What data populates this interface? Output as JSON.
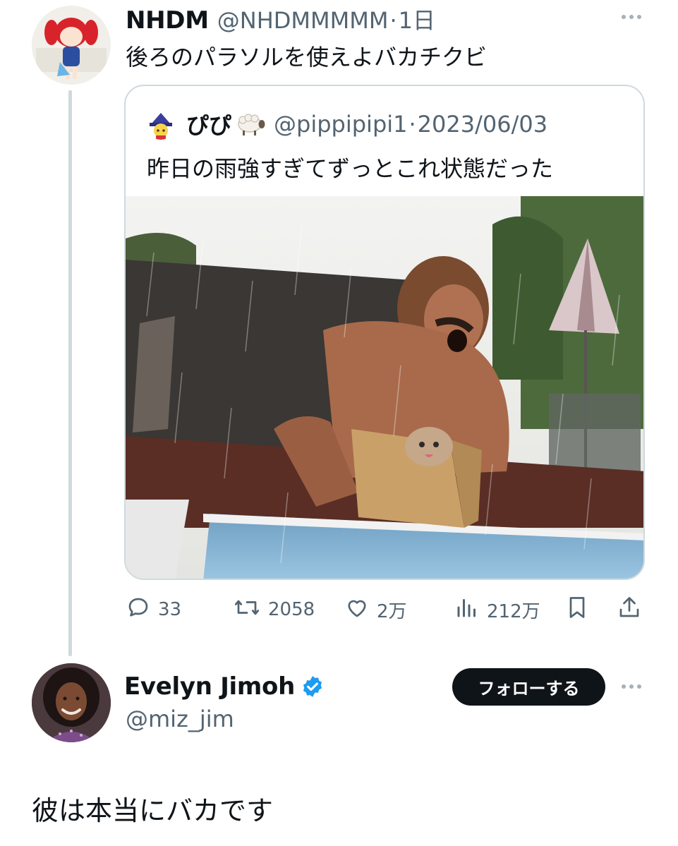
{
  "tweet": {
    "name": "NHDM",
    "handle": "@NHDMMMMM",
    "separator": "·",
    "time": "1日",
    "text": "後ろのパラソルを使えよバカチクビ"
  },
  "quote": {
    "name": "ぴぴ",
    "name_emoji": "sheep",
    "handle": "@pippipipi1",
    "separator": "·",
    "date": "2023/06/03",
    "text": "昨日の雨強すぎてずっとこれ状態だった"
  },
  "actions": {
    "replies": "33",
    "retweets": "2058",
    "likes": "2万",
    "views": "212万"
  },
  "reply": {
    "name": "Evelyn Jimoh",
    "handle": "@miz_jim",
    "follow_label": "フォローする",
    "text": "彼は本当にバカです",
    "verified_color": "#1d9bf0"
  },
  "icons": [
    "more-icon",
    "reply-icon",
    "retweet-icon",
    "like-icon",
    "views-icon",
    "bookmark-icon",
    "share-icon",
    "verified-badge-icon"
  ]
}
